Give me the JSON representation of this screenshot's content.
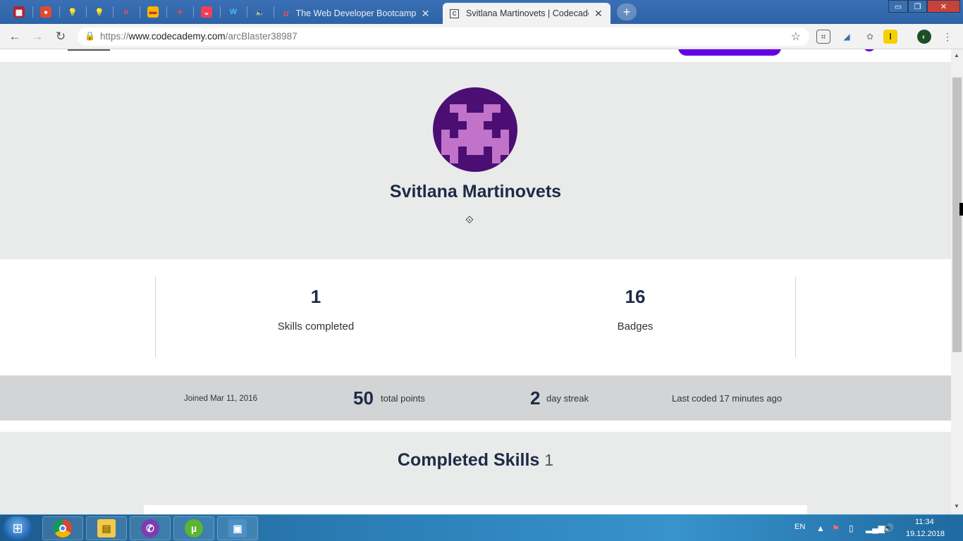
{
  "browser": {
    "tabs": [
      {
        "title": "The Web Developer Bootcamp | U",
        "active": false
      },
      {
        "title": "Svitlana Martinovets | Codecadem",
        "active": true
      }
    ],
    "close_glyph": "✕",
    "new_tab_glyph": "+",
    "url_prefix": "https://",
    "url_host": "www.codecademy.com",
    "url_path": "/arcBlaster38987",
    "window_controls": {
      "minimize": "▭",
      "restore": "❐",
      "close": "✕"
    }
  },
  "profile": {
    "name": "Svitlana Martinovets",
    "link_icon": "⟐",
    "stats": [
      {
        "value": "1",
        "label": "Skills completed"
      },
      {
        "value": "16",
        "label": "Badges"
      }
    ],
    "joined": "Joined Mar 11, 2016",
    "total_points_value": "50",
    "total_points_label": "total points",
    "streak_value": "2",
    "streak_label": "day streak",
    "last_coded": "Last coded 17 minutes ago"
  },
  "completed_skills": {
    "title": "Completed Skills",
    "count": "1"
  },
  "taskbar": {
    "language": "EN",
    "time": "11:34",
    "date": "19.12.2018"
  },
  "colors": {
    "brand_purple": "#6400e4",
    "avatar_bg": "#4b0f73",
    "avatar_fg": "#c173c9",
    "text_navy": "#1d2b45"
  }
}
